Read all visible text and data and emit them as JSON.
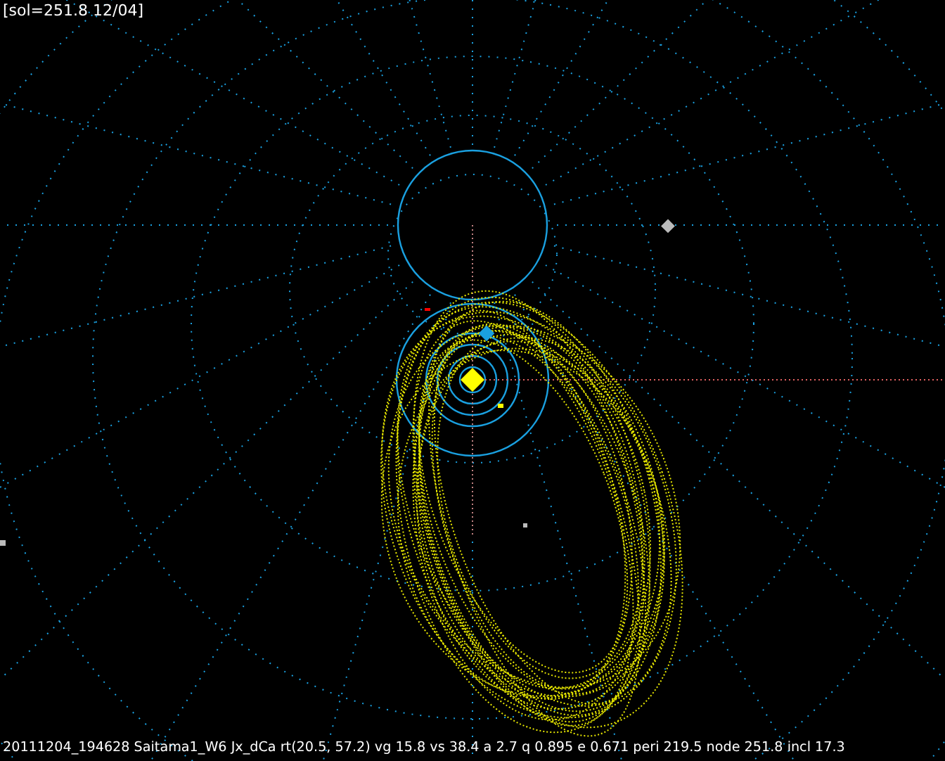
{
  "header": "[sol=251.8 12/04]",
  "caption": "20111204_194628 Saitama1_W6 Jx_dCa rt(20.5, 57.2) vg 15.8 vs 38.4 a 2.7 q 0.895 e 0.671 peri 219.5 node 251.8 incl 17.3"
}
